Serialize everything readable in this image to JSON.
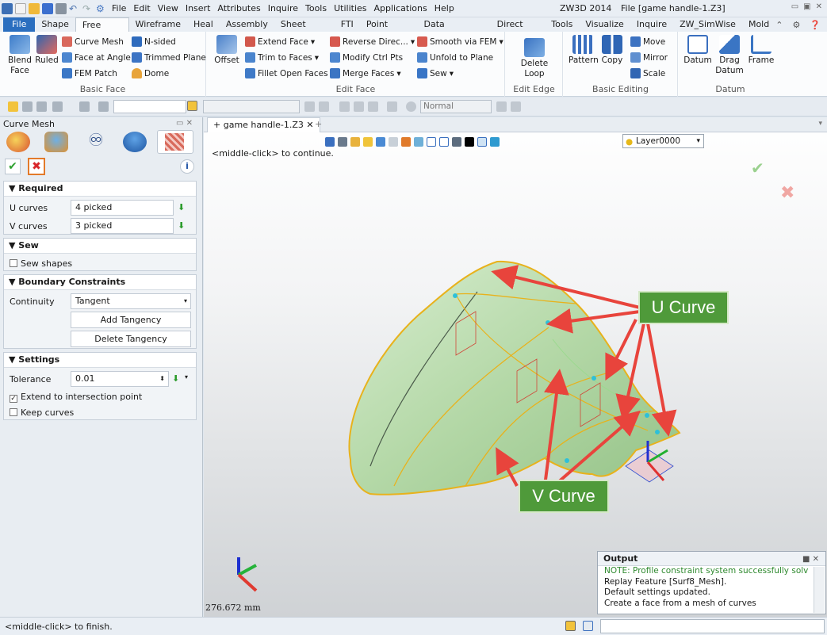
{
  "titlebar": {
    "menu": [
      "File",
      "Edit",
      "View",
      "Insert",
      "Attributes",
      "Inquire",
      "Tools",
      "Utilities",
      "Applications",
      "Help"
    ],
    "app_name": "ZW3D 2014",
    "file_title": "File [game handle-1.Z3]"
  },
  "ribbon_tabs": [
    "File",
    "Shape",
    "Free Form",
    "Wireframe",
    "Heal",
    "Assembly",
    "Sheet Metal",
    "FTI",
    "Point Cloud",
    "Data Exchange",
    "Direct Edit",
    "Tools",
    "Visualize",
    "Inquire",
    "ZW_SimWise",
    "Mold"
  ],
  "active_tab": "Free Form",
  "ribbon": {
    "basic_face": {
      "label": "Basic Face",
      "blend_face": "Blend\nFace",
      "ruled": "Ruled",
      "curve_mesh": "Curve Mesh",
      "face_at_angle": "Face at Angle",
      "fem_patch": "FEM Patch",
      "n_sided": "N-sided",
      "trimmed_plane": "Trimmed Plane",
      "dome": "Dome"
    },
    "edit_face": {
      "label": "Edit Face",
      "offset": "Offset",
      "extend_face": "Extend Face",
      "trim_to_faces": "Trim to Faces",
      "fillet_open_faces": "Fillet Open Faces",
      "reverse_direction": "Reverse Direc...",
      "modify_ctrl_pts": "Modify Ctrl Pts",
      "merge_faces": "Merge Faces",
      "smooth_via_fem": "Smooth via FEM",
      "unfold_to_plane": "Unfold to Plane",
      "sew": "Sew"
    },
    "edit_edge": {
      "label": "Edit Edge",
      "delete_loop": "Delete\nLoop"
    },
    "basic_editing": {
      "label": "Basic Editing",
      "pattern": "Pattern",
      "copy": "Copy",
      "move": "Move",
      "mirror": "Mirror",
      "scale": "Scale"
    },
    "datum": {
      "label": "Datum",
      "datum": "Datum",
      "drag_datum": "Drag\nDatum",
      "frame": "Frame"
    }
  },
  "toolbar2": {
    "render_mode": "Normal"
  },
  "left_panel": {
    "title": "Curve Mesh",
    "required": {
      "header": "Required",
      "u_label": "U curves",
      "u_value": "4 picked",
      "v_label": "V curves",
      "v_value": "3 picked"
    },
    "sew": {
      "header": "Sew",
      "sew_shapes": "Sew shapes"
    },
    "boundary": {
      "header": "Boundary Constraints",
      "continuity_label": "Continuity",
      "continuity_value": "Tangent",
      "add_tangency": "Add Tangency",
      "delete_tangency": "Delete Tangency"
    },
    "settings": {
      "header": "Settings",
      "tolerance_label": "Tolerance",
      "tolerance_value": "0.01",
      "extend": "Extend to intersection point",
      "keep_curves": "Keep curves"
    }
  },
  "viewport": {
    "doc_tab": "game handle-1.Z3",
    "layer": "Layer0000",
    "hint": "<middle-click> to continue.",
    "distance": "276.672 mm",
    "callout_u": "U Curve",
    "callout_v": "V Curve",
    "colors": {
      "shape_fill": "#b7d9ab",
      "edge": "#e8b21c",
      "arrow": "#e8443c",
      "callout": "#4f9a3a"
    }
  },
  "output": {
    "title": "Output",
    "lines": [
      "NOTE: Profile constraint system successfully solved.",
      "Replay Feature [Surf8_Mesh].",
      "Default settings updated.",
      "Create a face from a mesh of curves"
    ]
  },
  "status": {
    "text": "<middle-click> to finish."
  }
}
